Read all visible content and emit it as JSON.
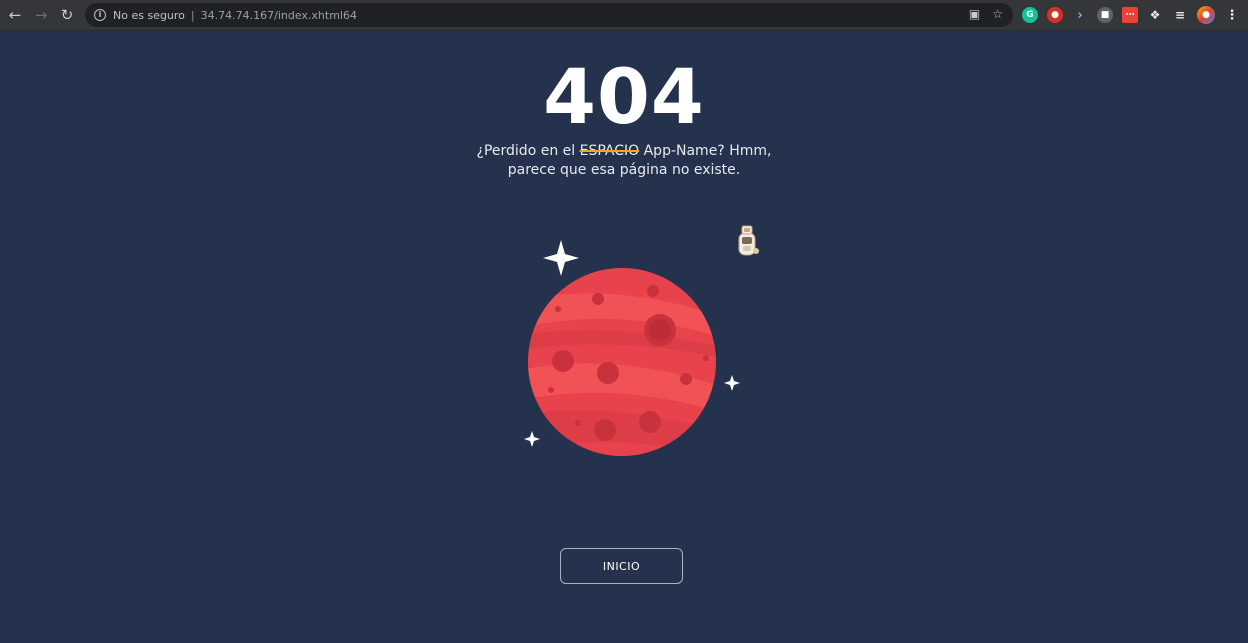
{
  "browser": {
    "back_icon": "arrow-left-icon",
    "forward_icon": "arrow-right-icon",
    "reload_icon": "reload-icon",
    "security_label": "No es seguro",
    "separator": "|",
    "url": "34.74.74.167/index.xhtml64"
  },
  "page": {
    "code": "404",
    "subtitle_part1": "¿Perdido en el ",
    "subtitle_strike": "ESPACIO",
    "subtitle_part2": " App-Name? Hmm,",
    "subtitle_line2": "parece que esa página no existe.",
    "button_label": "INICIO"
  },
  "colors": {
    "background": "#24324d",
    "planet": "#e8434c",
    "strike": "#f5a623"
  }
}
